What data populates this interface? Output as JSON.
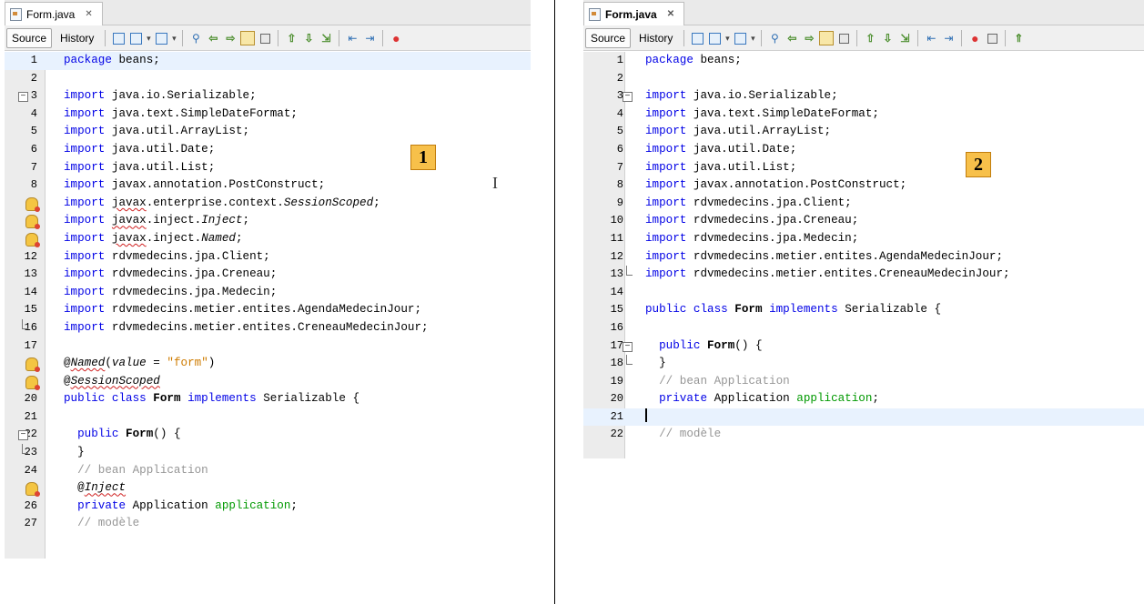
{
  "divider": true,
  "panels": [
    {
      "tab": {
        "title": "Form.java",
        "close": "✕"
      },
      "toolbar": {
        "source": "Source",
        "history": "History"
      },
      "badge": "1",
      "lines": [
        {
          "n": "1",
          "current": true,
          "html": "<span class=\"kw\">package</span> beans;"
        },
        {
          "n": "2",
          "html": ""
        },
        {
          "n": "3",
          "fold": "start",
          "html": "<span class=\"kw\">import</span> java.io.Serializable;"
        },
        {
          "n": "4",
          "html": "<span class=\"kw\">import</span> java.text.SimpleDateFormat;"
        },
        {
          "n": "5",
          "html": "<span class=\"kw\">import</span> java.util.ArrayList;"
        },
        {
          "n": "6",
          "html": "<span class=\"kw\">import</span> java.util.Date;"
        },
        {
          "n": "7",
          "html": "<span class=\"kw\">import</span> java.util.List;"
        },
        {
          "n": "8",
          "html": "<span class=\"kw\">import</span> javax.annotation.PostConstruct;"
        },
        {
          "n": "9",
          "bulb": true,
          "html": "<span class=\"kw\">import</span> <span class=\"sq\">javax</span>.enterprise.context.<span class=\"it\">SessionScoped</span>;"
        },
        {
          "n": "10",
          "bulb": true,
          "html": "<span class=\"kw\">import</span> <span class=\"sq\">javax</span>.inject.<span class=\"it\">Inject</span>;"
        },
        {
          "n": "11",
          "bulb": true,
          "html": "<span class=\"kw\">import</span> <span class=\"sq\">javax</span>.inject.<span class=\"it\">Named</span>;"
        },
        {
          "n": "12",
          "html": "<span class=\"kw\">import</span> rdvmedecins.jpa.Client;"
        },
        {
          "n": "13",
          "html": "<span class=\"kw\">import</span> rdvmedecins.jpa.Creneau;"
        },
        {
          "n": "14",
          "html": "<span class=\"kw\">import</span> rdvmedecins.jpa.Medecin;"
        },
        {
          "n": "15",
          "html": "<span class=\"kw\">import</span> rdvmedecins.metier.entites.AgendaMedecinJour;"
        },
        {
          "n": "16",
          "fold": "end",
          "html": "<span class=\"kw\">import</span> rdvmedecins.metier.entites.CreneauMedecinJour;"
        },
        {
          "n": "17",
          "html": ""
        },
        {
          "n": "18",
          "bulb": true,
          "html": "@<span class=\"it sq\">Named</span>(<span class=\"it\">value</span> = <span class=\"str\">\"form\"</span>)"
        },
        {
          "n": "19",
          "bulb": true,
          "html": "@<span class=\"it sq\">SessionScoped</span>"
        },
        {
          "n": "20",
          "html": "<span class=\"kw\">public class</span> <span class=\"bd\">Form</span> <span class=\"kw\">implements</span> Serializable {"
        },
        {
          "n": "21",
          "html": ""
        },
        {
          "n": "22",
          "fold": "start",
          "html": "  <span class=\"kw\">public</span> <span class=\"bd\">Form</span>() {"
        },
        {
          "n": "23",
          "fold": "end",
          "html": "  }"
        },
        {
          "n": "24",
          "html": "  <span class=\"cm\">// bean Application</span>"
        },
        {
          "n": "25",
          "bulb": true,
          "html": "  @<span class=\"it sq\">Inject</span>"
        },
        {
          "n": "26",
          "html": "  <span class=\"kw\">private</span> Application <span class=\"fld\">application</span>;"
        },
        {
          "n": "27",
          "html": "  <span class=\"cm\">// modèle</span>"
        }
      ]
    },
    {
      "tab": {
        "title": "Form.java",
        "close": "✕"
      },
      "toolbar": {
        "source": "Source",
        "history": "History"
      },
      "badge": "2",
      "lines": [
        {
          "n": "1",
          "html": "<span class=\"kw\">package</span> beans;"
        },
        {
          "n": "2",
          "html": ""
        },
        {
          "n": "3",
          "fold": "start",
          "html": "<span class=\"kw\">import</span> java.io.Serializable;"
        },
        {
          "n": "4",
          "html": "<span class=\"kw\">import</span> java.text.SimpleDateFormat;"
        },
        {
          "n": "5",
          "html": "<span class=\"kw\">import</span> java.util.ArrayList;"
        },
        {
          "n": "6",
          "html": "<span class=\"kw\">import</span> java.util.Date;"
        },
        {
          "n": "7",
          "html": "<span class=\"kw\">import</span> java.util.List;"
        },
        {
          "n": "8",
          "html": "<span class=\"kw\">import</span> javax.annotation.PostConstruct;"
        },
        {
          "n": "9",
          "html": "<span class=\"kw\">import</span> rdvmedecins.jpa.Client;"
        },
        {
          "n": "10",
          "html": "<span class=\"kw\">import</span> rdvmedecins.jpa.Creneau;"
        },
        {
          "n": "11",
          "html": "<span class=\"kw\">import</span> rdvmedecins.jpa.Medecin;"
        },
        {
          "n": "12",
          "html": "<span class=\"kw\">import</span> rdvmedecins.metier.entites.AgendaMedecinJour;"
        },
        {
          "n": "13",
          "fold": "end",
          "html": "<span class=\"kw\">import</span> rdvmedecins.metier.entites.CreneauMedecinJour;"
        },
        {
          "n": "14",
          "html": ""
        },
        {
          "n": "15",
          "html": "<span class=\"kw\">public class</span> <span class=\"bd\">Form</span> <span class=\"kw\">implements</span> Serializable {"
        },
        {
          "n": "16",
          "html": ""
        },
        {
          "n": "17",
          "fold": "start",
          "html": "  <span class=\"kw\">public</span> <span class=\"bd\">Form</span>() {"
        },
        {
          "n": "18",
          "fold": "end",
          "html": "  }"
        },
        {
          "n": "19",
          "html": "  <span class=\"cm\">// bean Application</span>"
        },
        {
          "n": "20",
          "html": "  <span class=\"kw\">private</span> Application <span class=\"fld\">application</span>;"
        },
        {
          "n": "21",
          "current": true,
          "caret": true,
          "html": ""
        },
        {
          "n": "22",
          "html": "  <span class=\"cm\">// modèle</span>"
        }
      ]
    }
  ]
}
